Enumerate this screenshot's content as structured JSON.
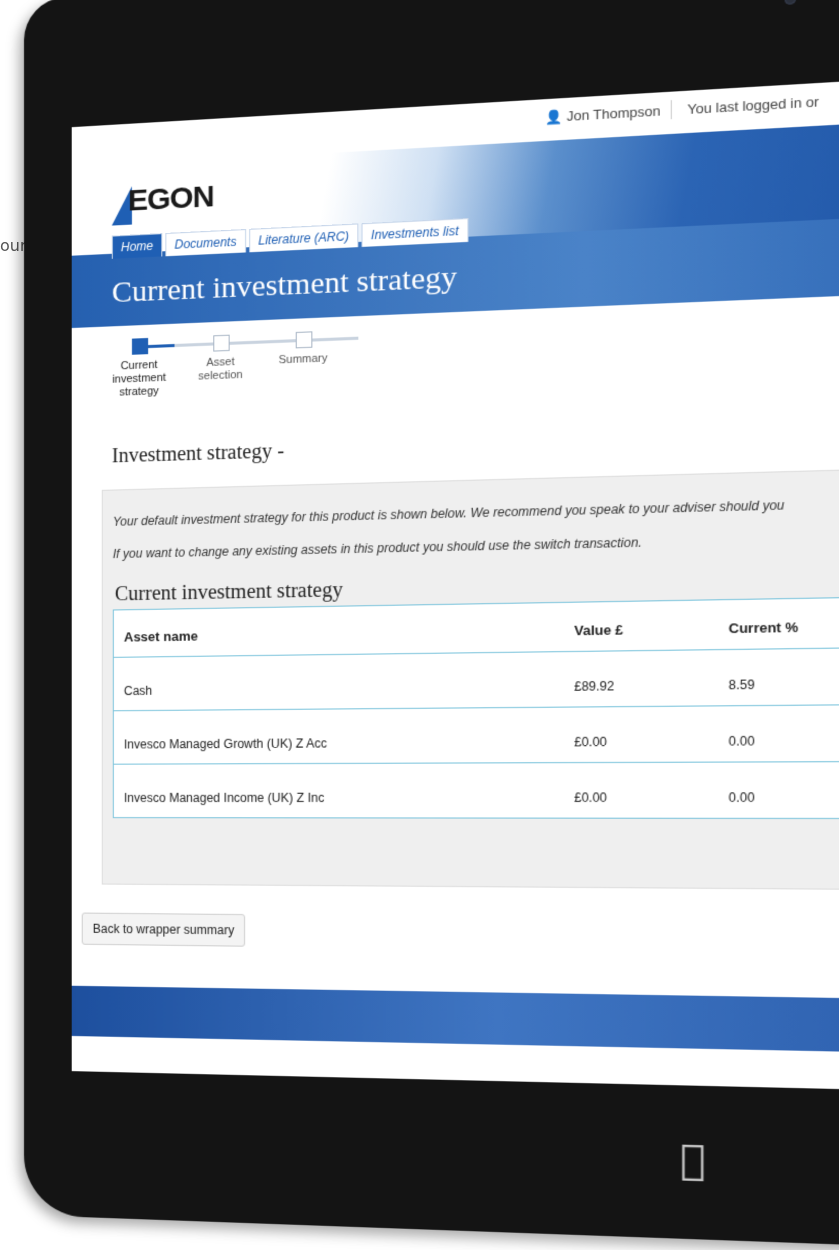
{
  "side_text": "our",
  "header": {
    "user_name": "Jon Thompson",
    "last_login": "You last logged in or"
  },
  "logo_text": "EGON",
  "tabs": [
    {
      "label": "Home",
      "active": true
    },
    {
      "label": "Documents",
      "active": false
    },
    {
      "label": "Literature (ARC)",
      "active": false
    },
    {
      "label": "Investments list",
      "active": false
    }
  ],
  "page_title": "Current investment strategy",
  "stepper": {
    "steps": [
      {
        "label": "Current investment strategy",
        "active": true
      },
      {
        "label": "Asset selection",
        "active": false
      },
      {
        "label": "Summary",
        "active": false
      }
    ]
  },
  "section_title": "Investment strategy -",
  "info": {
    "line1": "Your default investment strategy for this product is shown below. We recommend you speak to your adviser should you",
    "line2": "If you want to change any existing assets in this product you should use the switch transaction."
  },
  "table": {
    "title": "Current investment strategy",
    "headers": {
      "name": "Asset name",
      "value": "Value £",
      "pct": "Current %"
    },
    "rows": [
      {
        "name": "Cash",
        "value": "£89.92",
        "pct": "8.59"
      },
      {
        "name": "Invesco Managed Growth (UK) Z Acc",
        "value": "£0.00",
        "pct": "0.00"
      },
      {
        "name": "Invesco Managed Income (UK) Z Inc",
        "value": "£0.00",
        "pct": "0.00"
      }
    ]
  },
  "back_button": "Back to wrapper summary",
  "colors": {
    "accent": "#1f5fb4",
    "table_border": "#7cc4dc",
    "device": "#141414"
  }
}
